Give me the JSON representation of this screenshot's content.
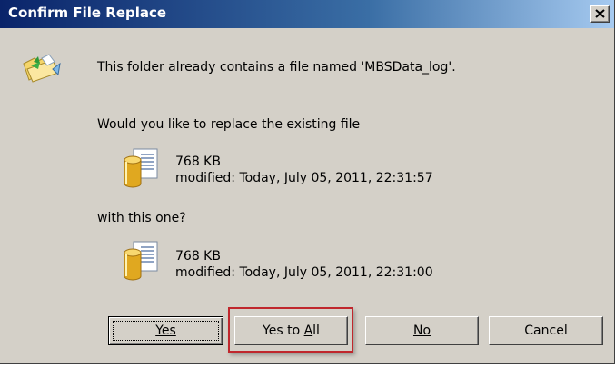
{
  "window": {
    "title": "Confirm File Replace",
    "close_glyph": "✕"
  },
  "message": {
    "line1": "This folder already contains a file named 'MBSData_log'.",
    "line2": "Would you like to replace the existing file",
    "line3": "with this one?"
  },
  "existing_file": {
    "size": "768 KB",
    "modified": "modified: Today, July 05, 2011, 22:31:57",
    "icon": "database-file-icon"
  },
  "new_file": {
    "size": "768 KB",
    "modified": "modified: Today, July 05, 2011, 22:31:00",
    "icon": "database-file-icon"
  },
  "buttons": {
    "yes": {
      "label": "Yes",
      "accel": "Y"
    },
    "yes_to_all": {
      "label": "Yes to All",
      "accel": "A"
    },
    "no": {
      "label": "No",
      "accel": "N"
    },
    "cancel": {
      "label": "Cancel"
    }
  },
  "colors": {
    "titlebar_start": "#0a246a",
    "titlebar_end": "#a6caf0",
    "dialog_face": "#d4d0c8",
    "highlight": "#c0272d"
  }
}
